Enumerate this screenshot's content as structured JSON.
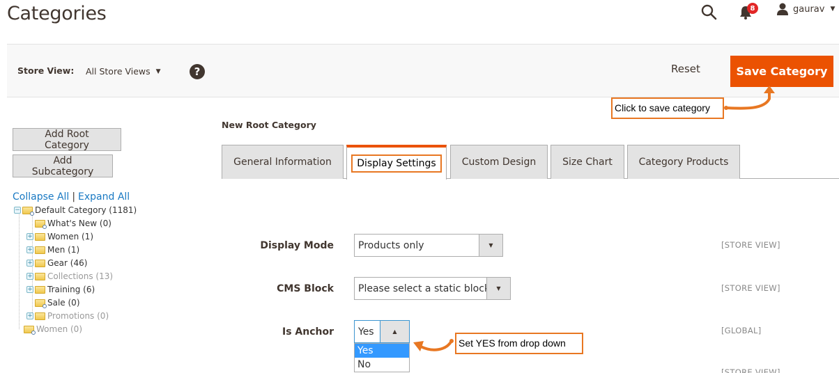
{
  "page": {
    "title": "Categories"
  },
  "header": {
    "notifications_count": "8",
    "user_name": "gaurav",
    "icons": {
      "search": "search-icon",
      "bell": "bell-icon",
      "user": "user-icon"
    }
  },
  "store_bar": {
    "label": "Store View:",
    "selected": "All Store Views",
    "help": "?",
    "reset_label": "Reset",
    "save_label": "Save Category"
  },
  "sidebar": {
    "add_root_label": "Add Root Category",
    "add_sub_label": "Add Subcategory",
    "collapse_label": "Collapse All",
    "separator": "|",
    "expand_label": "Expand All",
    "tree": [
      {
        "label": "Default Category (1181)",
        "expander": "⊟",
        "dim": false
      },
      {
        "label": "What's New (0)",
        "dim": false
      },
      {
        "label": "Women (1)",
        "expander": "⊞",
        "dim": false
      },
      {
        "label": "Men (1)",
        "expander": "⊞",
        "dim": false
      },
      {
        "label": "Gear (46)",
        "expander": "⊞",
        "dim": false
      },
      {
        "label": "Collections (13)",
        "expander": "⊞",
        "dim": true
      },
      {
        "label": "Training (6)",
        "expander": "⊞",
        "dim": false
      },
      {
        "label": "Sale (0)",
        "dim": false
      },
      {
        "label": "Promotions (0)",
        "expander": "⊞",
        "dim": true
      },
      {
        "label": "Women (0)",
        "dim": true
      }
    ]
  },
  "main": {
    "section_title": "New Root Category",
    "tabs": [
      {
        "label": "General Information",
        "active": false
      },
      {
        "label": "Display Settings",
        "active": true
      },
      {
        "label": "Custom Design",
        "active": false
      },
      {
        "label": "Size Chart",
        "active": false
      },
      {
        "label": "Category Products",
        "active": false
      }
    ],
    "fields": {
      "display_mode": {
        "label": "Display Mode",
        "value": "Products only",
        "scope": "[STORE VIEW]"
      },
      "cms_block": {
        "label": "CMS Block",
        "value": "Please select a static block.",
        "scope": "[STORE VIEW]"
      },
      "is_anchor": {
        "label": "Is Anchor",
        "value": "Yes",
        "scope": "[GLOBAL]",
        "options": [
          "Yes",
          "No"
        ],
        "highlighted": "Yes"
      },
      "next_scope": "[STORE VIEW]"
    }
  },
  "annotations": {
    "save_callout": "Click to save category",
    "anchor_callout": "Set YES from drop down",
    "color": "#e87722"
  },
  "colors": {
    "accent": "#eb5202",
    "link": "#1979c3",
    "selected_option": "#3399ff"
  }
}
